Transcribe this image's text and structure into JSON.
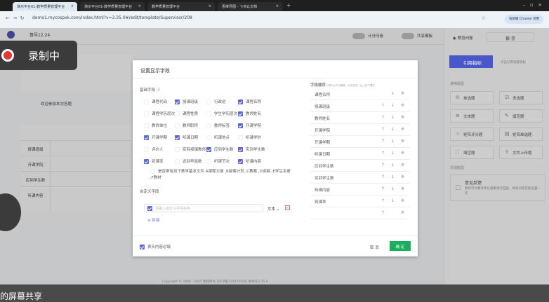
{
  "browser": {
    "tabs": [
      {
        "title": "演示平台01-教学质量管理平台"
      },
      {
        "title": "演示平台01-教学质量管理平台"
      },
      {
        "title": "教学质量管理平台"
      },
      {
        "title": "思维导图 - 飞书云文档"
      }
    ],
    "url": "demo1.mycospxk.com/index.html?v=3.35.0#/edit/template/Supervisor/208",
    "profile_label": "有新版 Chrome 可用"
  },
  "header": {
    "title": "督导12.24",
    "toggle_score": "计分问卷",
    "toggle_share": "共享模板",
    "preview": "预览问卷",
    "save": "保 存"
  },
  "recording": {
    "label": "录制中"
  },
  "left": {
    "welcome": "欢迎参加本次答题",
    "rows": [
      "授课班级",
      "开课学院",
      "应到学生数",
      "听课内容"
    ]
  },
  "right_panel": {
    "cite_button": "引用指标",
    "cite_hint": "点击引用海量指标",
    "common_title": "通用题型",
    "types": [
      {
        "label": "单选题",
        "icon": "radio-icon"
      },
      {
        "label": "多选题",
        "icon": "checkbox-icon"
      },
      {
        "label": "文本题",
        "icon": "text-icon"
      },
      {
        "label": "填空题",
        "icon": "edit-icon"
      },
      {
        "label": "矩阵评分题",
        "icon": "star-icon"
      },
      {
        "label": "矩阵单选题",
        "icon": "matrix-icon"
      },
      {
        "label": "填空题",
        "icon": "blank-icon"
      },
      {
        "label": "文件上传题",
        "icon": "upload-icon"
      }
    ],
    "feedback_title": "反馈题型",
    "feedback_name": "意见反馈",
    "feedback_desc": "教师可对督导评价结果进行回复。每张问卷仅能设置一次"
  },
  "dialog": {
    "title": "设置显示字段",
    "base_label": "基础字段",
    "fields": [
      [
        {
          "label": "课程代码",
          "checked": false
        },
        {
          "label": "授课班级",
          "checked": true
        },
        {
          "label": "行政班",
          "checked": false
        },
        {
          "label": "课程名称",
          "checked": true
        }
      ],
      [
        {
          "label": "课程学历层次",
          "checked": false
        },
        {
          "label": "课程性质",
          "checked": false
        },
        {
          "label": "学生学历层次",
          "checked": false
        },
        {
          "label": "教师姓名",
          "checked": true
        }
      ],
      [
        {
          "label": "教师单位",
          "checked": false
        },
        {
          "label": "教师职称",
          "checked": false
        },
        {
          "label": "教师标签",
          "checked": false
        },
        {
          "label": "开课学院",
          "checked": true
        }
      ],
      [
        {
          "label": "开课学期",
          "checked": true
        },
        {
          "label": "听课日期",
          "checked": true
        },
        {
          "label": "听课地点",
          "checked": false
        },
        {
          "label": "听课学时",
          "checked": false
        }
      ],
      [
        {
          "label": "评价人",
          "checked": false
        },
        {
          "label": "实际授课教师",
          "checked": false
        },
        {
          "label": "应到学生数",
          "checked": true
        },
        {
          "label": "实到学生数",
          "checked": true
        }
      ],
      [
        {
          "label": "到课率",
          "checked": true
        },
        {
          "label": "迟到早退数",
          "checked": false
        },
        {
          "label": "听课节次",
          "checked": false
        },
        {
          "label": "听课内容",
          "checked": true
        }
      ]
    ],
    "files_text": "是否带有如下教学基本文件 A课程大纲 ,B授课计划 ,C教案 ,D讲稿 ,E学生名册 ,F教材",
    "custom_label": "自定义字段",
    "custom_placeholder": "请输入自定义字段名称",
    "custom_type": "文本",
    "add_label": "新建",
    "order_title": "字段顺序",
    "order_hint": "*排头以下为顺序，从左至右，从上至下展示",
    "order": [
      "课程名称",
      "授课班级",
      "教师姓名",
      "开课学院",
      "开课学期",
      "听课日期",
      "应到学生数",
      "实到学生数",
      "听课内容",
      "到课率",
      ""
    ],
    "required_label": "表头内容必填",
    "cancel": "取 消",
    "confirm": "确 定"
  },
  "footer": "Copyright © 2006 - 2025 版权所有 京ICP备11047450号 版本号3.35.0",
  "share_text": "的屏幕共享",
  "colors": {
    "accent": "#5b68d8",
    "confirm": "#1aad5c",
    "record": "#e53935"
  }
}
